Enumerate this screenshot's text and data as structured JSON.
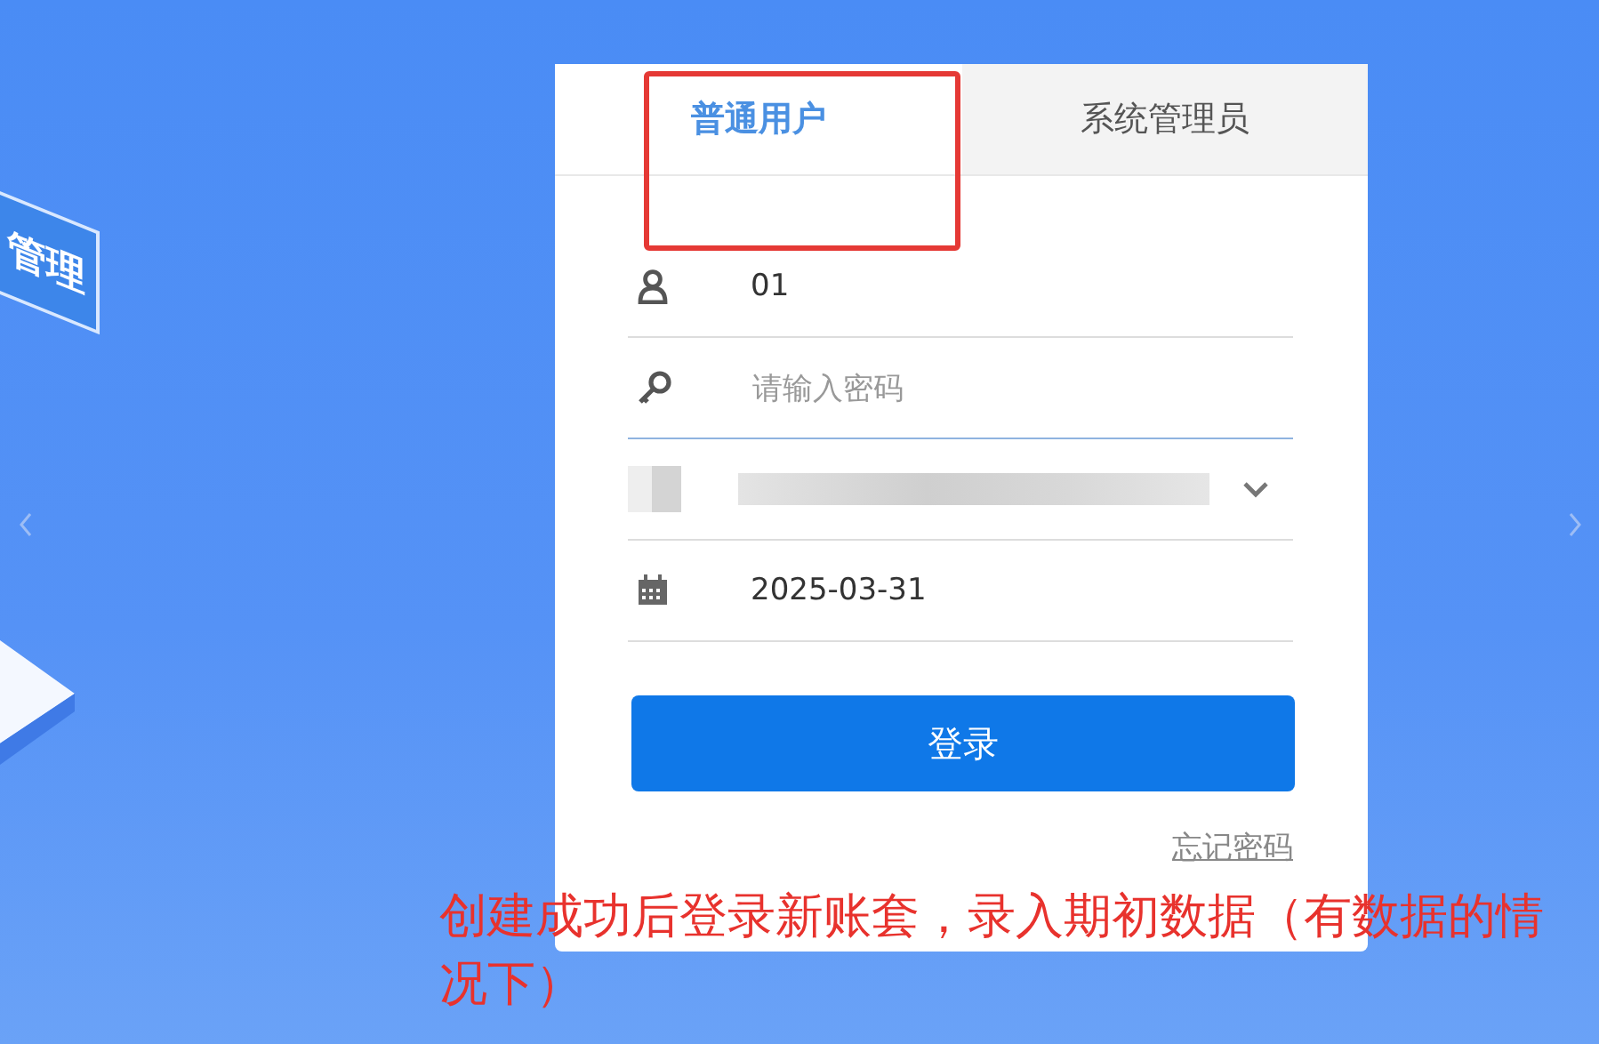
{
  "illustration": {
    "sign_text": "管理"
  },
  "tabs": [
    {
      "label": "普通用户",
      "selected": true
    },
    {
      "label": "系统管理员",
      "selected": false
    }
  ],
  "fields": [
    {
      "kind": "user",
      "value": "01",
      "focused": false
    },
    {
      "kind": "password",
      "placeholder": "请输入密码",
      "focused": true
    },
    {
      "kind": "select",
      "focused": false
    },
    {
      "kind": "date",
      "value": "2025-03-31",
      "focused": false
    }
  ],
  "login_button": "登录",
  "forgot_link": "忘记密码",
  "annotation": {
    "text": "创建成功后登录新账套，录入期初数据（有数据的情况下）"
  }
}
